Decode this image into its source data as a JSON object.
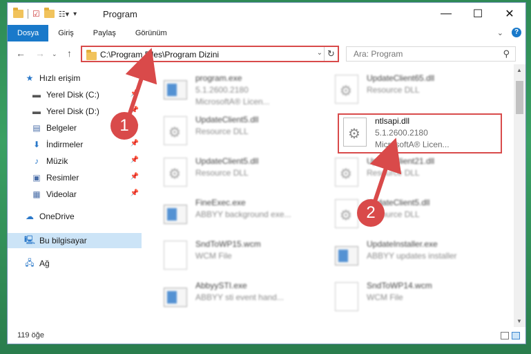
{
  "window": {
    "title": "Program",
    "controls": {
      "minimize": "—",
      "maximize": "☐",
      "close": "✕"
    }
  },
  "ribbon": {
    "tabs": [
      "Dosya",
      "Giriş",
      "Paylaş",
      "Görünüm"
    ]
  },
  "address": {
    "path": "C:\\Program Files\\Program Dizini",
    "search_placeholder": "Ara: Program"
  },
  "sidebar": {
    "items": [
      {
        "label": "Hızlı erişim",
        "icon": "star-icon"
      },
      {
        "label": "Yerel Disk (C:)",
        "icon": "drive-icon"
      },
      {
        "label": "Yerel Disk (D:)",
        "icon": "drive-icon"
      },
      {
        "label": "Belgeler",
        "icon": "documents-icon"
      },
      {
        "label": "İndirmeler",
        "icon": "download-icon"
      },
      {
        "label": "Müzik",
        "icon": "music-icon"
      },
      {
        "label": "Resimler",
        "icon": "pictures-icon"
      },
      {
        "label": "Videolar",
        "icon": "videos-icon"
      },
      {
        "label": "OneDrive",
        "icon": "cloud-icon"
      },
      {
        "label": "Bu bilgisayar",
        "icon": "computer-icon"
      },
      {
        "label": "Ağ",
        "icon": "network-icon"
      }
    ]
  },
  "files": [
    {
      "name": "program.exe",
      "line2": "5.1.2600.2180",
      "line3": "MicrosoftA® Licen..."
    },
    {
      "name": "UpdateClient65.dll",
      "line2": "Resource DLL",
      "line3": ""
    },
    {
      "name": "UpdateClient5.dll",
      "line2": "Resource DLL",
      "line3": ""
    },
    {
      "name": "ntlsapi.dll",
      "line2": "5.1.2600.2180",
      "line3": "MicrosoftA® Licen..."
    },
    {
      "name": "UpdateClient5.dll",
      "line2": "Resource DLL",
      "line3": ""
    },
    {
      "name": "UpdateClient21.dll",
      "line2": "Resource DLL",
      "line3": ""
    },
    {
      "name": "FineExec.exe",
      "line2": "ABBYY background exe...",
      "line3": ""
    },
    {
      "name": "UpdateClient5.dll",
      "line2": "Resource DLL",
      "line3": ""
    },
    {
      "name": "SndToWP15.wcm",
      "line2": "WCM File",
      "line3": ""
    },
    {
      "name": "UpdateInstaller.exe",
      "line2": "ABBYY updates installer",
      "line3": ""
    },
    {
      "name": "AbbyySTI.exe",
      "line2": "ABBYY sti event hand...",
      "line3": ""
    },
    {
      "name": "SndToWP14.wcm",
      "line2": "WCM File",
      "line3": ""
    }
  ],
  "status": {
    "count": "119 öğe"
  },
  "callouts": {
    "one": "1",
    "two": "2"
  },
  "colors": {
    "accent": "#1979ca",
    "highlight": "#d84a4a",
    "desktop": "#2e8a55"
  }
}
